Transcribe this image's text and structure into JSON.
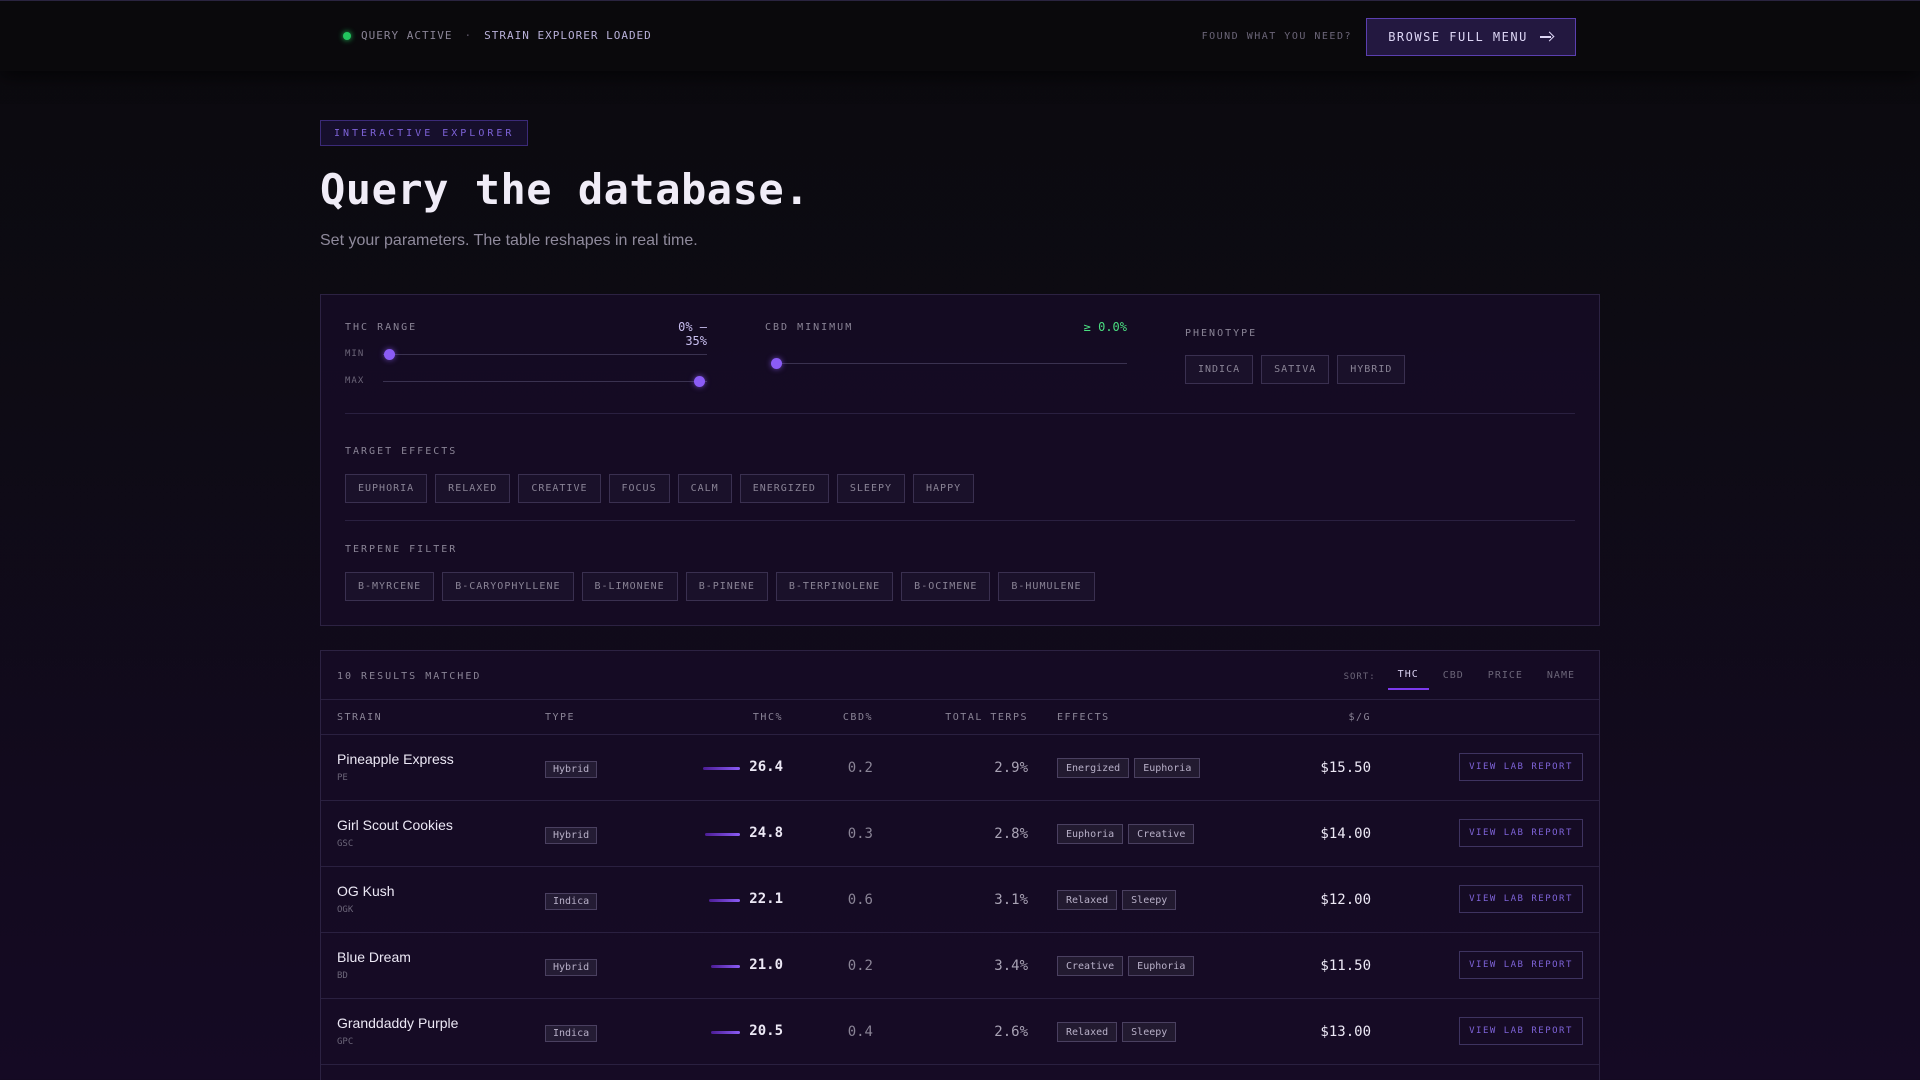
{
  "topbar": {
    "status_primary": "QUERY ACTIVE",
    "status_separator": "·",
    "status_secondary": "STRAIN EXPLORER LOADED",
    "found_text": "FOUND WHAT YOU NEED?",
    "browse_label": "BROWSE FULL MENU",
    "status_dot_color": "#22c55e"
  },
  "hero": {
    "badge": "INTERACTIVE EXPLORER",
    "title": "Query the database.",
    "subtitle": "Set your parameters. The table reshapes in real time."
  },
  "filters": {
    "thc": {
      "label": "THC RANGE",
      "value": "0% – 35%",
      "min_label": "MIN",
      "max_label": "MAX",
      "min": 0,
      "max": 35,
      "scale_max": 35
    },
    "cbd": {
      "label": "CBD MINIMUM",
      "value": "≥ 0.0%",
      "min": 0.0,
      "scale_max": 20
    },
    "phenotype": {
      "label": "PHENOTYPE",
      "options": [
        "INDICA",
        "SATIVA",
        "HYBRID"
      ]
    },
    "effects": {
      "label": "TARGET EFFECTS",
      "options": [
        "EUPHORIA",
        "RELAXED",
        "CREATIVE",
        "FOCUS",
        "CALM",
        "ENERGIZED",
        "SLEEPY",
        "HAPPY"
      ]
    },
    "terpenes": {
      "label": "TERPENE FILTER",
      "options": [
        "Β-MYRCENE",
        "Β-CARYOPHYLLENE",
        "Β-LIMONENE",
        "Β-PINENE",
        "Β-TERPINOLENE",
        "Β-OCIMENE",
        "Β-HUMULENE"
      ]
    }
  },
  "results": {
    "count_label": "10 RESULTS MATCHED",
    "sort_label": "SORT:",
    "sort_options": [
      "THC",
      "CBD",
      "PRICE",
      "NAME"
    ],
    "sort_active": "THC",
    "headers": {
      "strain": "STRAIN",
      "type": "TYPE",
      "thc": "THC%",
      "cbd": "CBD%",
      "terps": "TOTAL TERPS",
      "effects": "EFFECTS",
      "price": "$/G"
    },
    "lab_label": "VIEW LAB REPORT",
    "rows": [
      {
        "name": "Pineapple Express",
        "code": "PE",
        "type": "Hybrid",
        "thc": "26.4",
        "thc_value": 26.4,
        "cbd": "0.2",
        "terps": "2.9%",
        "effects": [
          "Energized",
          "Euphoria"
        ],
        "price": "$15.50"
      },
      {
        "name": "Girl Scout Cookies",
        "code": "GSC",
        "type": "Hybrid",
        "thc": "24.8",
        "thc_value": 24.8,
        "cbd": "0.3",
        "terps": "2.8%",
        "effects": [
          "Euphoria",
          "Creative"
        ],
        "price": "$14.00"
      },
      {
        "name": "OG Kush",
        "code": "OGK",
        "type": "Indica",
        "thc": "22.1",
        "thc_value": 22.1,
        "cbd": "0.6",
        "terps": "3.1%",
        "effects": [
          "Relaxed",
          "Sleepy"
        ],
        "price": "$12.00"
      },
      {
        "name": "Blue Dream",
        "code": "BD",
        "type": "Hybrid",
        "thc": "21.0",
        "thc_value": 21.0,
        "cbd": "0.2",
        "terps": "3.4%",
        "effects": [
          "Creative",
          "Euphoria"
        ],
        "price": "$11.50"
      },
      {
        "name": "Granddaddy Purple",
        "code": "GPC",
        "type": "Indica",
        "thc": "20.5",
        "thc_value": 20.5,
        "cbd": "0.4",
        "terps": "2.6%",
        "effects": [
          "Relaxed",
          "Sleepy"
        ],
        "price": "$13.00"
      }
    ]
  },
  "colors": {
    "accent": "#8b5cf6",
    "accent_dark": "#4c1d95",
    "cbd_value": "#4ade80"
  }
}
